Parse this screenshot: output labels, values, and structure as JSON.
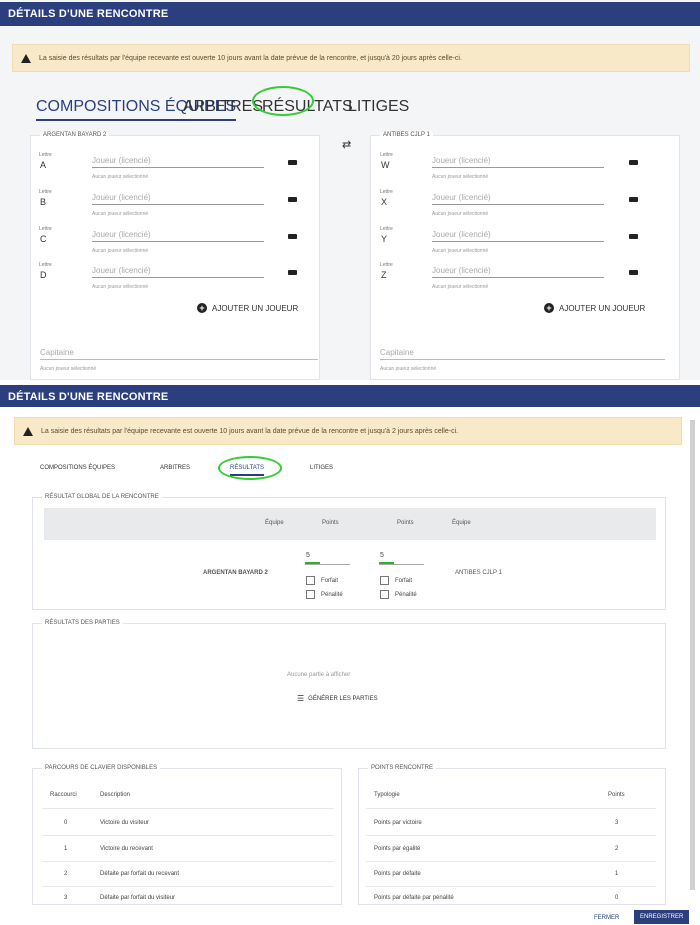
{
  "dialog_top": {
    "title": "DÉTAILS D'UNE RENCONTRE",
    "warning": "La saisie des résultats par l'équipe recevante est ouverte 10 jours avant la date prévue de la rencontre, et jusqu'à 20 jours après celle-ci.",
    "tabs": [
      "COMPOSITIONS ÉQUIPES",
      "ARBITRES",
      "RÉSULTATS",
      "LITIGES"
    ],
    "swap_icon": "⇄",
    "team_left": {
      "name": "ARGENTAN BAYARD 2",
      "players": [
        {
          "label": "Lettre",
          "letter": "A",
          "placeholder": "Joueur (licencié)",
          "sub": "Aucun joueur sélectionné"
        },
        {
          "label": "Lettre",
          "letter": "B",
          "placeholder": "Joueur (licencié)",
          "sub": "Aucun joueur sélectionné"
        },
        {
          "label": "Lettre",
          "letter": "C",
          "placeholder": "Joueur (licencié)",
          "sub": "Aucun joueur sélectionné"
        },
        {
          "label": "Lettre",
          "letter": "D",
          "placeholder": "Joueur (licencié)",
          "sub": "Aucun joueur sélectionné"
        }
      ],
      "add_label": "AJOUTER UN JOUEUR",
      "captain_placeholder": "Capitaine",
      "captain_sub": "Aucun joueur sélectionné"
    },
    "team_right": {
      "name": "ANTIBES CJLP 1",
      "players": [
        {
          "label": "Lettre",
          "letter": "W",
          "placeholder": "Joueur (licencié)",
          "sub": "Aucun joueur sélectionné"
        },
        {
          "label": "Lettre",
          "letter": "X",
          "placeholder": "Joueur (licencié)",
          "sub": "Aucun joueur sélectionné"
        },
        {
          "label": "Lettre",
          "letter": "Y",
          "placeholder": "Joueur (licencié)",
          "sub": "Aucun joueur sélectionné"
        },
        {
          "label": "Lettre",
          "letter": "Z",
          "placeholder": "Joueur (licencié)",
          "sub": "Aucun joueur sélectionné"
        }
      ],
      "add_label": "AJOUTER UN JOUEUR",
      "captain_placeholder": "Capitaine",
      "captain_sub": "Aucun joueur sélectionné"
    }
  },
  "dialog_bottom": {
    "title": "DÉTAILS D'UNE RENCONTRE",
    "warning": "La saisie des résultats par l'équipe recevante est ouverte 10 jours avant la date prévue de la rencontre et jusqu'à 2 jours après celle-ci.",
    "tabs": [
      "COMPOSITIONS ÉQUIPES",
      "ARBITRES",
      "RÉSULTATS",
      "LITIGES"
    ],
    "global_result": {
      "title": "RÉSULTAT GLOBAL DE LA RENCONTRE",
      "headers": [
        "Équipe",
        "Points",
        "Points",
        "Équipe"
      ],
      "team_left": "ARGENTAN BAYARD 2",
      "team_right": "ANTIBES CJLP 1",
      "score_left": "5",
      "score_right": "5",
      "forfait_label": "Forfait",
      "penalite_label": "Pénalité"
    },
    "parties": {
      "title": "RÉSULTATS DES PARTIES",
      "empty": "Aucune partie à afficher",
      "generate_label": "GÉNÉRER LES PARTIES"
    },
    "barometre": {
      "title": "PARCOURS DE CLAVIER DISPONIBLES",
      "headers": [
        "Raccourci",
        "Description"
      ],
      "rows": [
        [
          "0",
          "Victoire du visiteur"
        ],
        [
          "1",
          "Victoire du recevant"
        ],
        [
          "2",
          "Défaite par forfait du recevant"
        ],
        [
          "3",
          "Défaite par forfait du visiteur"
        ]
      ]
    },
    "points": {
      "title": "POINTS RENCONTRE",
      "headers": [
        "Typologie",
        "Points"
      ],
      "rows": [
        [
          "Points par victoire",
          "3"
        ],
        [
          "Points par égalité",
          "2"
        ],
        [
          "Points par défaite",
          "1"
        ],
        [
          "Points par défaite par pénalité",
          "0"
        ]
      ]
    },
    "footer": {
      "close_label": "FERMER",
      "save_label": "ENREGISTRER"
    }
  }
}
